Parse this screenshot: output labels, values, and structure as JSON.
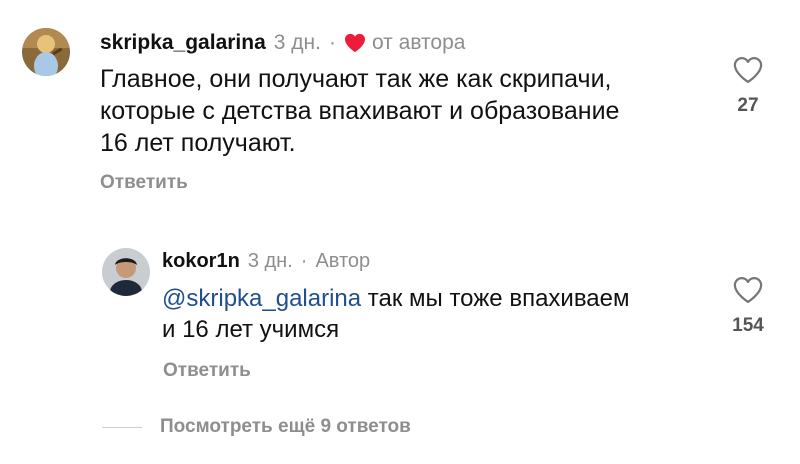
{
  "comment": {
    "username": "skripka_galarina",
    "time": "3 дн.",
    "separator": "·",
    "author_like_label": "от автора",
    "text_lines": [
      "Главное, они получают так же как скрипачи,",
      "которые с детства впахивают и образование",
      "16 лет получают."
    ],
    "reply_label": "Ответить",
    "like_count": "27",
    "colors": {
      "heart_badge": "#ed1c3a"
    },
    "icons": {
      "like": "heart-outline-icon",
      "badge": "heart-filled-icon"
    }
  },
  "reply": {
    "username": "kokor1n",
    "time": "3 дн.",
    "separator": "·",
    "author_label": "Автор",
    "mention": "@skripka_galarina",
    "text_after_mention": " так мы тоже впахиваем",
    "text_line2": "и 16 лет учимся",
    "reply_label": "Ответить",
    "like_count": "154",
    "colors": {
      "mention": "#1f4f8f"
    },
    "icons": {
      "like": "heart-outline-icon"
    }
  },
  "more_replies_label": "Посмотреть ещё 9 ответов"
}
